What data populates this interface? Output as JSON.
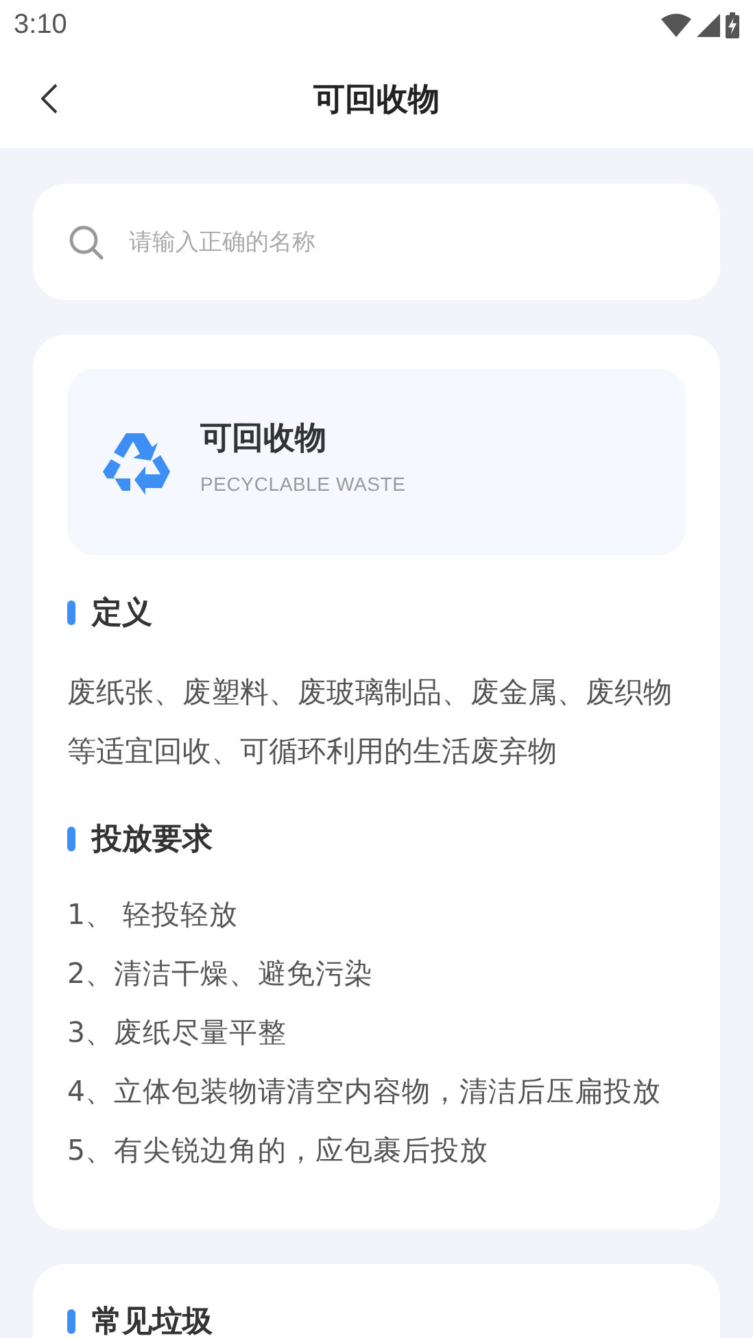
{
  "status_bar": {
    "time": "3:10"
  },
  "header": {
    "title": "可回收物"
  },
  "search": {
    "placeholder": "请输入正确的名称"
  },
  "category": {
    "title": "可回收物",
    "subtitle": "PECYCLABLE WASTE"
  },
  "sections": [
    {
      "title": "定义",
      "kind": "paragraph",
      "text": "废纸张、废塑料、废玻璃制品、废金属、废织物等适宜回收、可循环利用的生活废弃物"
    },
    {
      "title": "投放要求",
      "kind": "list",
      "items": [
        "1、 轻投轻放",
        "2、清洁干燥、避免污染",
        "3、废纸尽量平整",
        "4、立体包装物请清空内容物，清洁后压扁投放",
        "5、有尖锐边角的，应包裹后投放"
      ]
    }
  ],
  "next_card": {
    "title": "常见垃圾"
  }
}
